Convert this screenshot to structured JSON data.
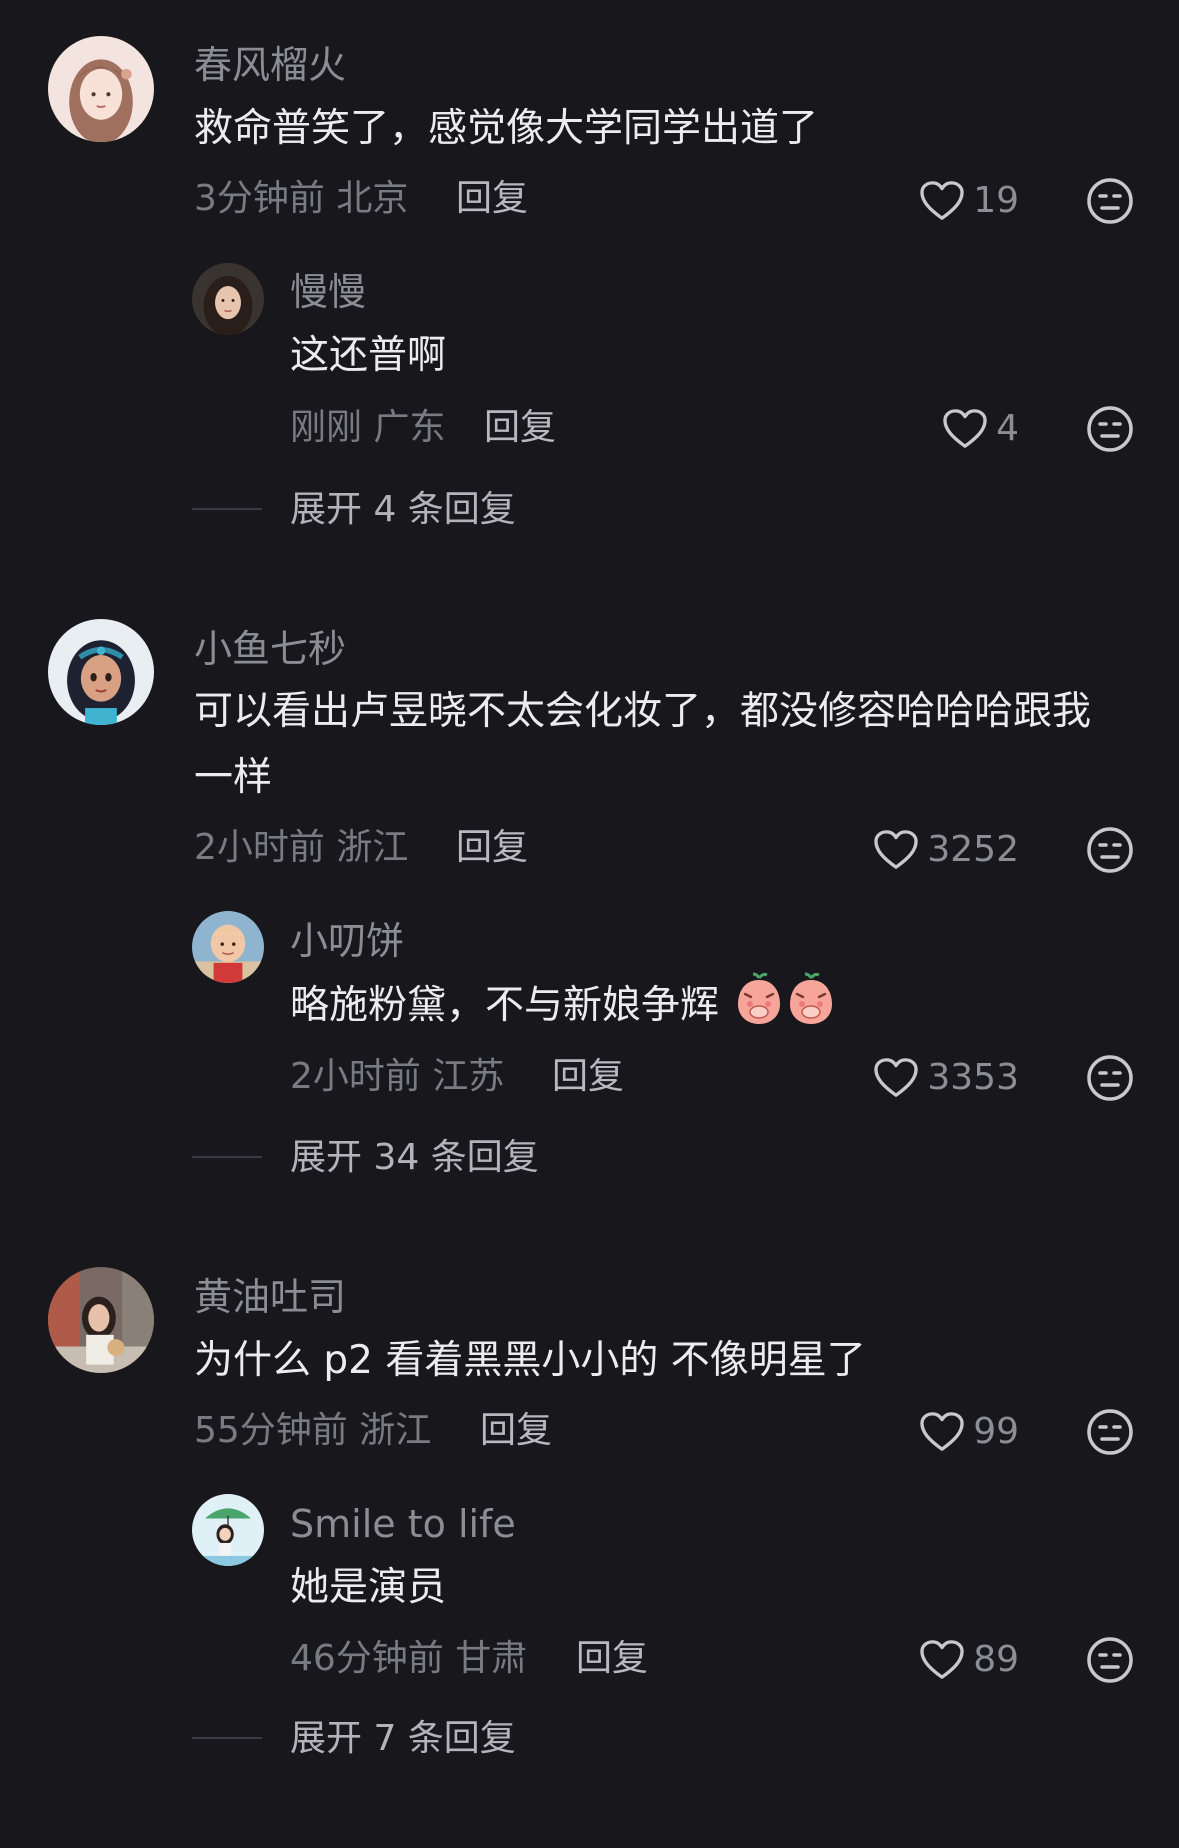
{
  "comments": [
    {
      "username": "春风榴火",
      "text": "救命普笑了，感觉像大学同学出道了",
      "time": "3分钟前",
      "location": "北京",
      "reply_label": "回复",
      "likes": "19",
      "avatar_icon": "girl-illustration-avatar",
      "replies": [
        {
          "username": "慢慢",
          "text": "这还普啊",
          "time": "刚刚",
          "location": "广东",
          "reply_label": "回复",
          "likes": "4",
          "avatar_icon": "woman-photo-avatar"
        }
      ],
      "expand_label": "展开 4 条回复"
    },
    {
      "username": "小鱼七秒",
      "text": "可以看出卢昱晓不太会化妆了，都没修容哈哈哈跟我一样",
      "time": "2小时前",
      "location": "浙江",
      "reply_label": "回复",
      "likes": "3252",
      "avatar_icon": "princess-cartoon-avatar",
      "replies": [
        {
          "username": "小叨饼",
          "text": "略施粉黛，不与新娘争辉",
          "time": "2小时前",
          "location": "江苏",
          "reply_label": "回复",
          "likes": "3353",
          "avatar_icon": "child-photo-avatar",
          "emoji": [
            "peach-cover-mouth-emoji",
            "peach-cover-mouth-emoji"
          ]
        }
      ],
      "expand_label": "展开 34 条回复"
    },
    {
      "username": "黄油吐司",
      "text": "为什么 p2 看着黑黑小小的 不像明星了",
      "time": "55分钟前",
      "location": "浙江",
      "reply_label": "回复",
      "likes": "99",
      "avatar_icon": "street-photo-avatar",
      "replies": [
        {
          "username": "Smile to life",
          "text": "她是演员",
          "time": "46分钟前",
          "location": "甘肃",
          "reply_label": "回复",
          "likes": "89",
          "avatar_icon": "umbrella-girl-cartoon-avatar"
        }
      ],
      "expand_label": "展开 7 条回复"
    }
  ],
  "colors": {
    "background": "#17171c",
    "username": "#8c8c93",
    "text": "#ececef",
    "meta": "#7a7a81"
  }
}
